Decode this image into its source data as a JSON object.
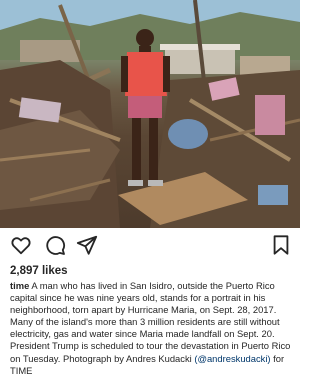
{
  "post": {
    "photo_alt_icon": "photo",
    "likes": "2,897 likes",
    "caption": {
      "username": "time",
      "text_before_mention": " A man who has lived in San Isidro, outside the Puerto Rico capital since he was nine years old, stands for a portrait in his neighborhood, torn apart by Hurricane Maria, on Sept. 28, 2017. Many of the island's more than 3 million residents are still without electricity, gas and water since Maria made landfall on Sept. 20. President Trump is scheduled to tour the devastation in Puerto Rico on Tuesday. Photograph by Andres Kudacki ",
      "mention": "(@andreskudacki)",
      "text_after_mention": " for TIME"
    }
  },
  "actions": {
    "like_icon": "heart-icon",
    "comment_icon": "comment-icon",
    "share_icon": "share-icon",
    "save_icon": "bookmark-icon"
  }
}
